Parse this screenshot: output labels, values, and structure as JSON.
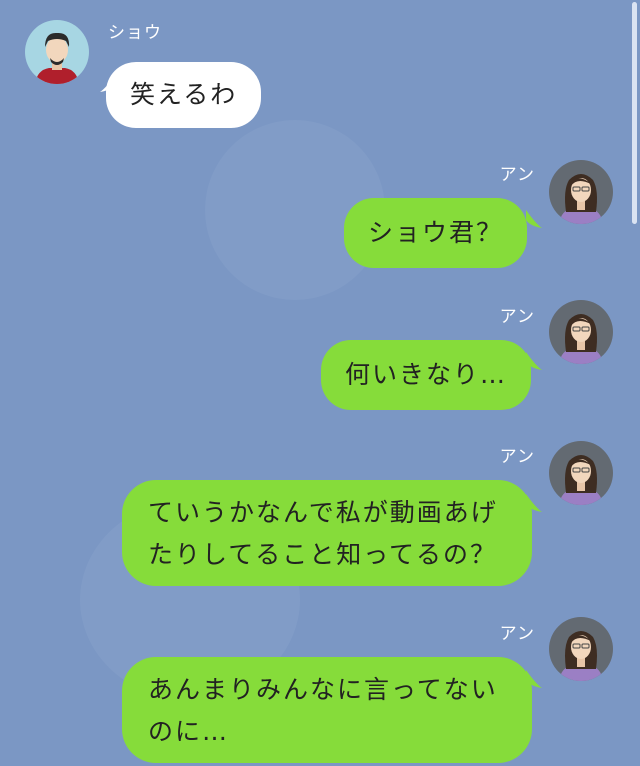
{
  "colors": {
    "background": "#7b97c4",
    "sent_bubble": "#86dc3a",
    "received_bubble": "#ffffff"
  },
  "messages": [
    {
      "sender": "ショウ",
      "text": "笑えるわ",
      "side": "left"
    },
    {
      "sender": "アン",
      "text": "ショウ君？",
      "side": "right"
    },
    {
      "sender": "アン",
      "text": "何いきなり…",
      "side": "right"
    },
    {
      "sender": "アン",
      "lines": [
        "ていうかなんで私が動画あげ",
        "たりしてること知ってるの？"
      ],
      "side": "right"
    },
    {
      "sender": "アン",
      "lines": [
        "あんまりみんなに言ってない",
        "のに…"
      ],
      "side": "right"
    }
  ],
  "icons": {
    "male_avatar": "man-avatar-icon",
    "female_avatar": "woman-avatar-icon"
  }
}
